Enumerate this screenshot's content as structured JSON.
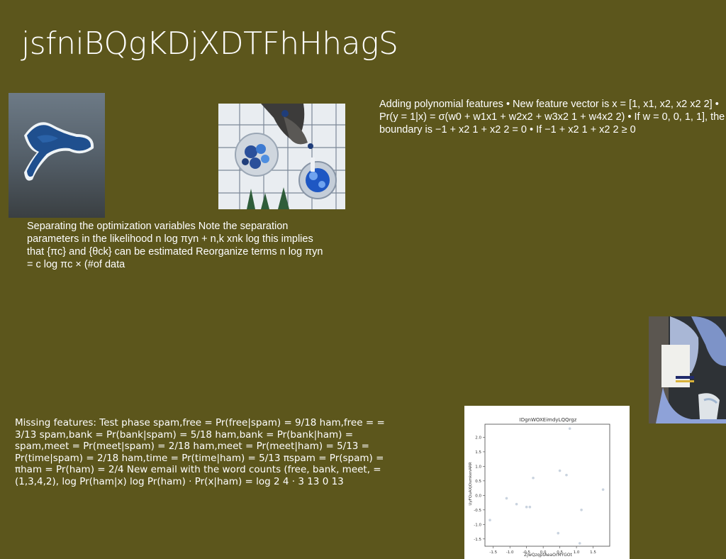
{
  "slide": {
    "title": "jsfniBQgKDjXDTFhHhagS",
    "background": "#5c561c"
  },
  "text_blocks": {
    "polynomial": "Adding polynomial features • New feature vector is x = [1, x1, x2, x2 x2 2] • Pr(y = 1|x) = σ(w0 + w1x1 + w2x2 + w3x2 1 + w4x2 2) • If w = 0, 0, 1, 1], the boundary is −1 + x2 1 + x2 2 = 0 • If −1 + x2 1 + x2 2 ≥ 0",
    "separating": "Separating the optimization variables Note the separation parameters in the likelihood  n log πyn +  n,k xnk log this implies that {πc} and {θck} can be estimated Reorganize terms  n log πyn =  c log πc × (#of data",
    "missing": "Missing features: Test phase spam,free = Pr(free|spam) = 9/18 ham,free = = 3/13 spam,bank = Pr(bank|spam) = 5/18 ham,bank = Pr(bank|ham) = spam,meet = Pr(meet|spam) = 2/18 ham,meet = Pr(meet|ham) = 5/13 = Pr(time|spam) = 2/18 ham,time = Pr(time|ham) = 5/13 πspam = Pr(spam) = πham = Pr(ham) = 2/4 New email with the word counts (free, bank, meet, = (1,3,4,2), log Pr(ham|x)  log Pr(ham) · Pr(x|ham) = log  2 4 ·  3 13   0 13"
  },
  "chart_data": {
    "type": "scatter",
    "title": "IDgnWOXEimdyLQQrgz",
    "xlabel": "ZjwQzqptAeaOrMYGOt",
    "ylabel": "UyFQuAXjOsmkenARR",
    "xlim": [
      -1.75,
      2.0
    ],
    "ylim": [
      -1.75,
      2.45
    ],
    "xticks": [
      "-1.5",
      "-1.0",
      "-0.5",
      "0.0",
      "0.5",
      "1.0",
      "1.5"
    ],
    "yticks": [
      "-1.5",
      "-1.0",
      "-0.5",
      "0.0",
      "0.5",
      "1.0",
      "1.5",
      "2.0"
    ],
    "points": [
      {
        "x": -1.6,
        "y": -0.85
      },
      {
        "x": -1.1,
        "y": -0.1
      },
      {
        "x": -0.8,
        "y": -0.3
      },
      {
        "x": -0.5,
        "y": -0.4
      },
      {
        "x": -0.4,
        "y": -0.4
      },
      {
        "x": -0.3,
        "y": 0.6
      },
      {
        "x": 0.45,
        "y": -1.3
      },
      {
        "x": 0.5,
        "y": 0.85
      },
      {
        "x": 0.7,
        "y": 0.7
      },
      {
        "x": 0.8,
        "y": 2.3
      },
      {
        "x": 1.1,
        "y": -1.65
      },
      {
        "x": 1.15,
        "y": -0.5
      },
      {
        "x": 1.8,
        "y": 0.2
      }
    ],
    "marker_color": "#c9d3df",
    "grid": false,
    "legend": "none"
  }
}
